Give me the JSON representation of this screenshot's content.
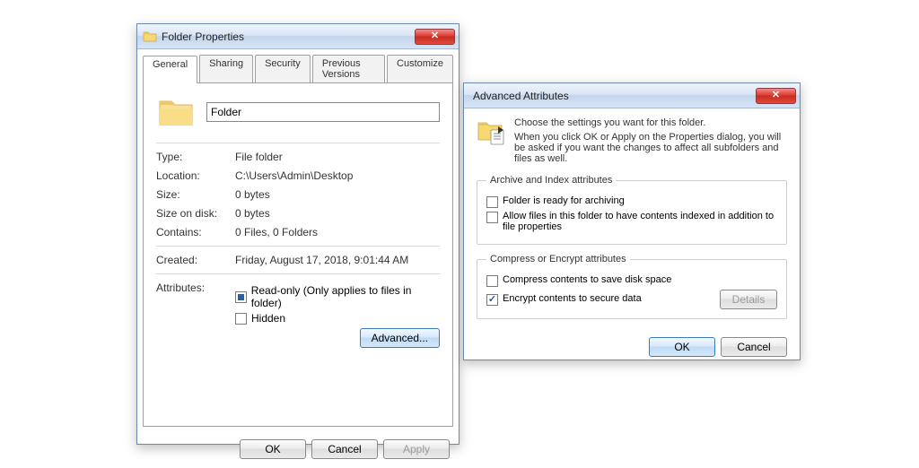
{
  "props": {
    "title": "Folder Properties",
    "tabs": [
      "General",
      "Sharing",
      "Security",
      "Previous Versions",
      "Customize"
    ],
    "folder_name": "Folder",
    "rows": {
      "type_label": "Type:",
      "type_value": "File folder",
      "location_label": "Location:",
      "location_value": "C:\\Users\\Admin\\Desktop",
      "size_label": "Size:",
      "size_value": "0 bytes",
      "sizeod_label": "Size on disk:",
      "sizeod_value": "0 bytes",
      "contains_label": "Contains:",
      "contains_value": "0 Files, 0 Folders",
      "created_label": "Created:",
      "created_value": "Friday, August 17, 2018, 9:01:44 AM",
      "attributes_label": "Attributes:",
      "readonly_label": "Read-only (Only applies to files in folder)",
      "hidden_label": "Hidden",
      "advanced_btn": "Advanced..."
    },
    "buttons": {
      "ok": "OK",
      "cancel": "Cancel",
      "apply": "Apply"
    }
  },
  "adv": {
    "title": "Advanced Attributes",
    "header_line1": "Choose the settings you want for this folder.",
    "header_line2": "When you click OK or Apply on the Properties dialog, you will be asked if you want the changes to affect all subfolders and files as well.",
    "group1_legend": "Archive and Index attributes",
    "archive_label": "Folder is ready for archiving",
    "index_label": "Allow files in this folder to have contents indexed in addition to file properties",
    "group2_legend": "Compress or Encrypt attributes",
    "compress_label": "Compress contents to save disk space",
    "encrypt_label": "Encrypt contents to secure data",
    "details_btn": "Details",
    "buttons": {
      "ok": "OK",
      "cancel": "Cancel"
    }
  }
}
